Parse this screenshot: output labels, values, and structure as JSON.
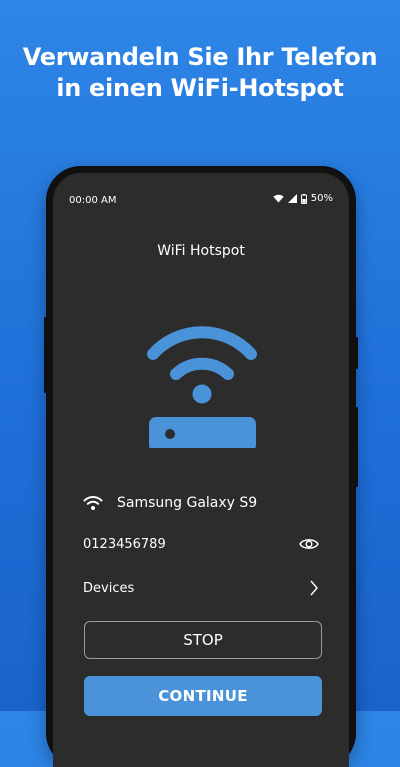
{
  "headline": {
    "line1": "Verwandeln Sie Ihr Telefon",
    "line2": "in einen WiFi-Hotspot"
  },
  "status_bar": {
    "time": "00:00 AM",
    "battery": "50%",
    "icons": [
      "wifi-icon",
      "signal-icon",
      "battery-icon"
    ]
  },
  "app": {
    "title": "WiFi Hotspot",
    "hero_icon": "router-wifi-icon",
    "network_name": "Samsung Galaxy S9",
    "password": "0123456789",
    "devices_label": "Devices",
    "stop_label": "STOP",
    "continue_label": "CONTINUE"
  },
  "colors": {
    "background_blue": "#2e86e6",
    "screen_bg": "#2c2c2c",
    "accent_blue": "#4a93d8"
  }
}
